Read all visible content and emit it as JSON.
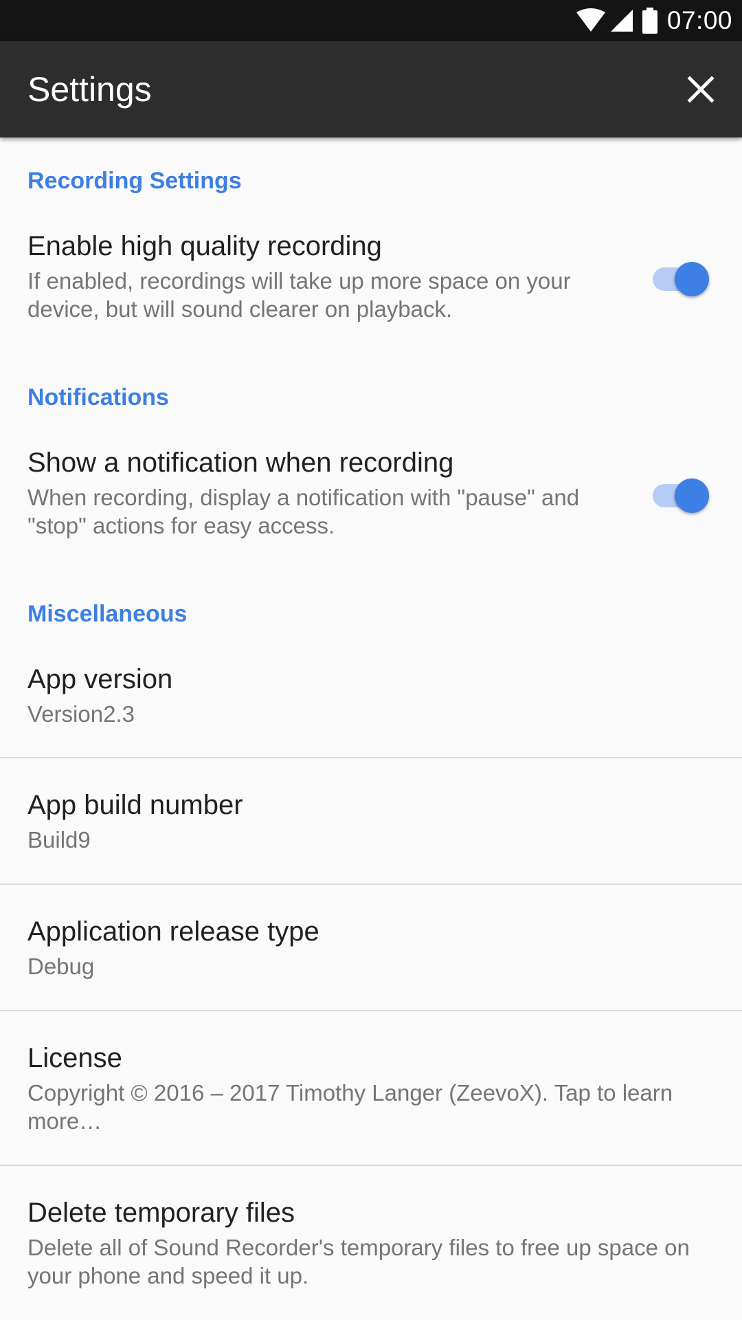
{
  "status_bar": {
    "time": "07:00",
    "icons": [
      "wifi-icon",
      "cell-signal-icon",
      "battery-icon"
    ]
  },
  "app_bar": {
    "title": "Settings",
    "close_icon": "close-icon"
  },
  "colors": {
    "accent": "#3d7fe4",
    "app_bar": "#2d2d2d",
    "status_bar": "#141414",
    "background": "#fafafa"
  },
  "sections": [
    {
      "header": "Recording Settings",
      "items": [
        {
          "title": "Enable high quality recording",
          "summary": "If enabled, recordings will take up more space on your device, but will sound clearer on playback.",
          "toggle": true
        }
      ]
    },
    {
      "header": "Notifications",
      "items": [
        {
          "title": "Show a notification when recording",
          "summary": "When recording, display a notification with \"pause\" and \"stop\" actions for easy access.",
          "toggle": true
        }
      ]
    },
    {
      "header": "Miscellaneous",
      "items": [
        {
          "title": "App version",
          "summary": "Version2.3"
        },
        {
          "title": "App build number",
          "summary": "Build9"
        },
        {
          "title": "Application release type",
          "summary": "Debug"
        },
        {
          "title": "License",
          "summary": "Copyright © 2016 – 2017 Timothy Langer (ZeevoX). Tap to learn more…"
        },
        {
          "title": "Delete temporary files",
          "summary": "Delete all of Sound Recorder's temporary files to free up space on your phone and speed it up."
        }
      ]
    }
  ]
}
